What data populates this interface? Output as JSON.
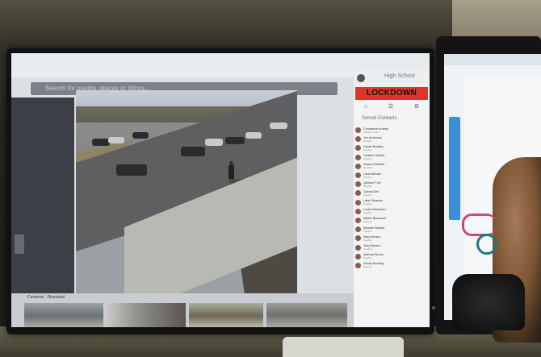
{
  "app": {
    "search_placeholder": "Search for people, places or things...",
    "school_name": "High School",
    "status_banner": "LOCKDOWN",
    "panel_tabs": [
      "home-icon",
      "list-icon",
      "settings-icon"
    ],
    "contacts_title": "School Contacts",
    "contacts": [
      {
        "name": "Constance Aubrey",
        "meta": "Assistant Princ."
      },
      {
        "name": "Jim Anderson",
        "meta": "Teacher"
      },
      {
        "name": "Daniel Bradley",
        "meta": "Teacher"
      },
      {
        "name": "Heather McNeil",
        "meta": "Teacher"
      },
      {
        "name": "Susan Hubbard",
        "meta": "Teacher"
      },
      {
        "name": "Luna Benson",
        "meta": "Teacher"
      },
      {
        "name": "Quinton Folk",
        "meta": "Teacher"
      },
      {
        "name": "Garcia Dell",
        "meta": "Teacher"
      },
      {
        "name": "Lake Simpson",
        "meta": "Teacher"
      },
      {
        "name": "Louis Robertson",
        "meta": "Teacher"
      },
      {
        "name": "Walter Blackwell",
        "meta": "Teacher"
      },
      {
        "name": "Michael Ballard",
        "meta": "Teacher"
      },
      {
        "name": "Mary Brosen",
        "meta": "Teacher"
      },
      {
        "name": "Jerry Brosen",
        "meta": "Teacher"
      },
      {
        "name": "Mathew Brown",
        "meta": "Teacher"
      },
      {
        "name": "Sandy Bowling",
        "meta": "Teacher"
      }
    ],
    "thumb_tabs": [
      "Cameras",
      "Dismissal"
    ],
    "colors": {
      "lockdown": "#e0332a",
      "side_strip": "#3a8fd6"
    }
  }
}
